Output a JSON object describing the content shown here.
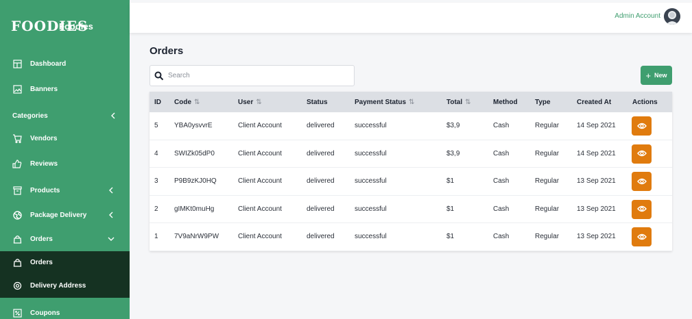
{
  "brand": {
    "logo_text": "FOODIES",
    "name": "Foodies"
  },
  "sidebar": {
    "items": [
      {
        "label": "Dashboard",
        "icon": "layout-icon"
      },
      {
        "label": "Banners",
        "icon": "image-icon"
      },
      {
        "label": "Categories",
        "icon": "chevron-left-icon"
      },
      {
        "label": "Vendors",
        "icon": "cart-icon"
      },
      {
        "label": "Reviews",
        "icon": "thumbs-up-icon"
      },
      {
        "label": "Products",
        "icon": "archive-icon"
      },
      {
        "label": "Package Delivery",
        "icon": "globe-icon"
      },
      {
        "label": "Orders",
        "icon": "bag-icon"
      },
      {
        "label": "Orders",
        "icon": "bag-icon",
        "active": true
      },
      {
        "label": "Delivery Address",
        "icon": "map-pin-icon"
      },
      {
        "label": "Coupons",
        "icon": "coupon-icon"
      }
    ]
  },
  "topbar": {
    "user_label": "Admin Account"
  },
  "main": {
    "title": "Orders",
    "search_placeholder": "Search",
    "new_label": "New",
    "columns": {
      "id": "ID",
      "code": "Code",
      "user": "User",
      "status": "Status",
      "payment_status": "Payment Status",
      "total": "Total",
      "method": "Method",
      "type": "Type",
      "created_at": "Created At",
      "actions": "Actions"
    },
    "rows": [
      {
        "id": "5",
        "code": "YBA0ysvvrE",
        "user": "Client Account",
        "status": "delivered",
        "payment_status": "successful",
        "total": "$3,9",
        "method": "Cash",
        "type": "Regular",
        "created_at": "14 Sep 2021"
      },
      {
        "id": "4",
        "code": "SWIZk05dP0",
        "user": "Client Account",
        "status": "delivered",
        "payment_status": "successful",
        "total": "$3,9",
        "method": "Cash",
        "type": "Regular",
        "created_at": "14 Sep 2021"
      },
      {
        "id": "3",
        "code": "P9B9zKJ0HQ",
        "user": "Client Account",
        "status": "delivered",
        "payment_status": "successful",
        "total": "$1",
        "method": "Cash",
        "type": "Regular",
        "created_at": "13 Sep 2021"
      },
      {
        "id": "2",
        "code": "gIMKt0muHg",
        "user": "Client Account",
        "status": "delivered",
        "payment_status": "successful",
        "total": "$1",
        "method": "Cash",
        "type": "Regular",
        "created_at": "13 Sep 2021"
      },
      {
        "id": "1",
        "code": "7V9aNrW9PW",
        "user": "Client Account",
        "status": "delivered",
        "payment_status": "successful",
        "total": "$1",
        "method": "Cash",
        "type": "Regular",
        "created_at": "13 Sep 2021"
      }
    ]
  },
  "colors": {
    "primary": "#3f9e6f",
    "active_nav": "#153222",
    "action": "#e07b0e",
    "header_row": "#dcdfe4"
  }
}
